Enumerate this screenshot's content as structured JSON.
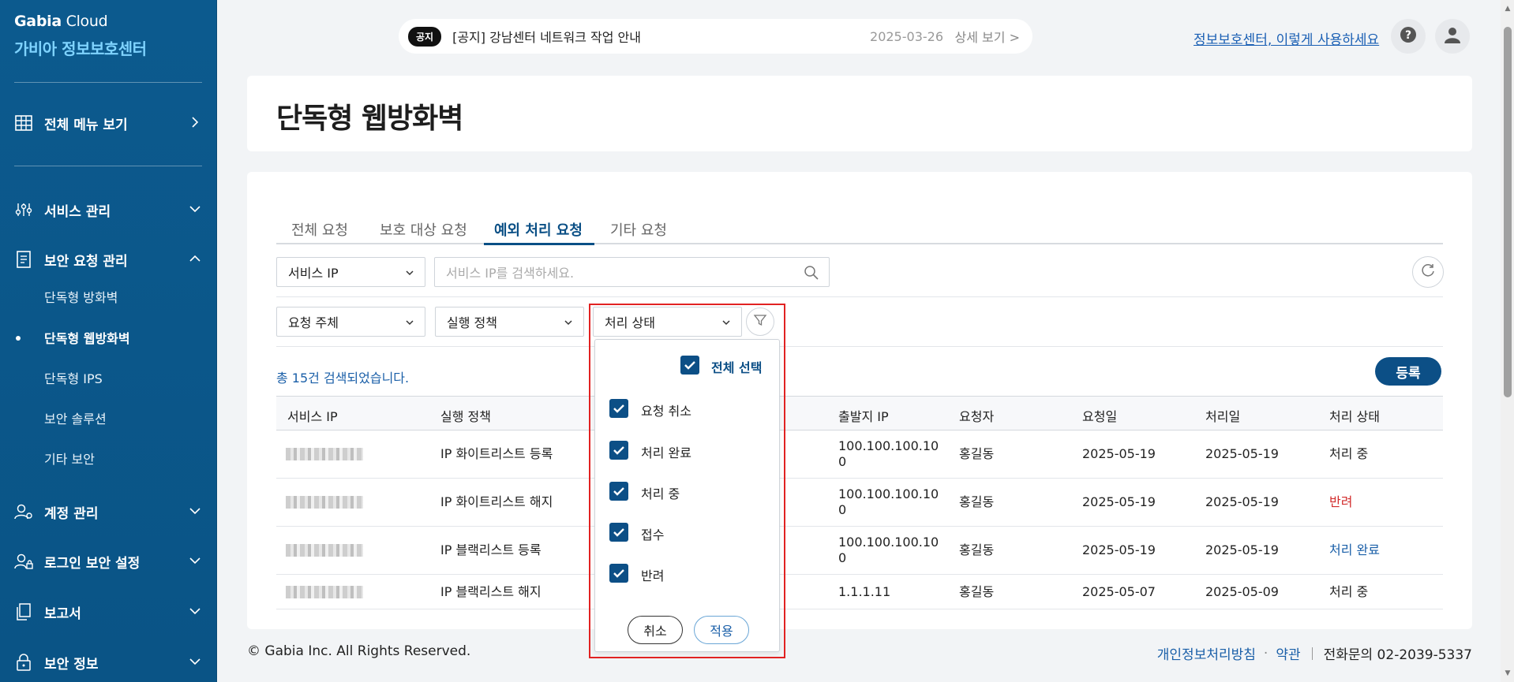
{
  "sidebar": {
    "brand_bold": "Gabia",
    "brand_light": " Cloud",
    "brand_sub": "가비아 정보보호센터",
    "all_menu": "전체 메뉴 보기",
    "menu": [
      {
        "label": "서비스 관리"
      },
      {
        "label": "보안 요청 관리"
      },
      {
        "label": "계정 관리"
      },
      {
        "label": "로그인 보안 설정"
      },
      {
        "label": "보고서"
      },
      {
        "label": "보안 정보"
      }
    ],
    "submenu": [
      {
        "label": "단독형 방화벽"
      },
      {
        "label": "단독형 웹방화벽"
      },
      {
        "label": "단독형 IPS"
      },
      {
        "label": "보안 솔루션"
      },
      {
        "label": "기타 보안"
      }
    ]
  },
  "notice": {
    "badge": "공지",
    "text": "[공지] 강남센터 네트워크 작업 안내",
    "date": "2025-03-26",
    "more": "상세 보기 >"
  },
  "header": {
    "guide_link": "정보보호센터, 이렇게 사용하세요"
  },
  "page": {
    "title": "단독형 웹방화벽"
  },
  "tabs": [
    "전체 요청",
    "보호 대상 요청",
    "예외 처리 요청",
    "기타 요청"
  ],
  "filters": {
    "search_type": "서비스 IP",
    "search_placeholder": "서비스 IP를 검색하세요.",
    "requester": "요청 주체",
    "policy": "실행 정책",
    "status": "처리 상태"
  },
  "results": {
    "count_text": "총 15건 검색되었습니다.",
    "register_button": "등록"
  },
  "table": {
    "headers": [
      "서비스 IP",
      "실행 정책",
      "출발지 IP",
      "요청자",
      "요청일",
      "처리일",
      "처리 상태"
    ],
    "rows": [
      {
        "policy": "IP 화이트리스트 등록",
        "src_ip_1": "100.100.100.10",
        "src_ip_2": "0",
        "requester": "홍길동",
        "req_date": "2025-05-19",
        "proc_date": "2025-05-19",
        "status": "처리 중"
      },
      {
        "policy": "IP 화이트리스트 해지",
        "src_ip_1": "100.100.100.10",
        "src_ip_2": "0",
        "requester": "홍길동",
        "req_date": "2025-05-19",
        "proc_date": "2025-05-19",
        "status": "반려"
      },
      {
        "policy": "IP 블랙리스트 등록",
        "src_ip_1": "100.100.100.10",
        "src_ip_2": "0",
        "requester": "홍길동",
        "req_date": "2025-05-19",
        "proc_date": "2025-05-19",
        "status": "처리 완료"
      },
      {
        "policy": "IP 블랙리스트 해지",
        "src_ip_1": "1.1.1.11",
        "src_ip_2": "",
        "requester": "홍길동",
        "req_date": "2025-05-07",
        "proc_date": "2025-05-09",
        "status": "처리 중"
      }
    ]
  },
  "status_dropdown": {
    "select_all": "전체 선택",
    "options": [
      "요청 취소",
      "처리 완료",
      "처리 중",
      "접수",
      "반려"
    ],
    "cancel": "취소",
    "apply": "적용"
  },
  "footer": {
    "copyright": "© Gabia Inc. All Rights Reserved.",
    "privacy": "개인정보처리방침",
    "terms": "약관",
    "phone": "전화문의 02-2039-5337"
  },
  "colors": {
    "sidebar_bg": "#0c5a8e",
    "brand_accent": "#7fd3ff",
    "primary": "#0c4f86",
    "link": "#1a5fa8",
    "reject": "#d22b2b",
    "highlight_outline": "#e12222"
  }
}
